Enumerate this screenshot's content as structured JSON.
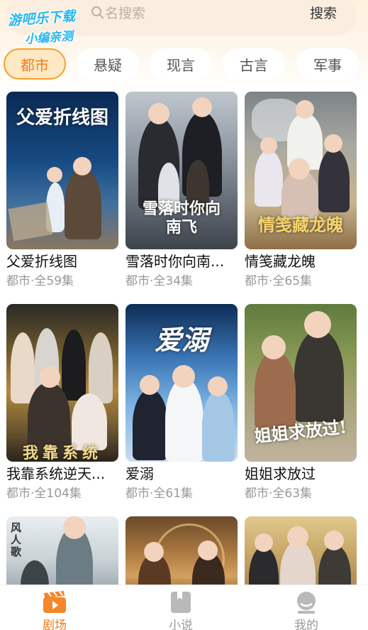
{
  "watermark": {
    "line1": "游吧乐下载",
    "line2": "小编亲测"
  },
  "search": {
    "placeholder": "名搜索",
    "button_label": "搜索"
  },
  "tabs": [
    {
      "label": "都市",
      "active": true
    },
    {
      "label": "悬疑",
      "active": false
    },
    {
      "label": "现言",
      "active": false
    },
    {
      "label": "古言",
      "active": false
    },
    {
      "label": "军事",
      "active": false
    }
  ],
  "dramas": [
    {
      "title": "父爱折线图",
      "meta": "都市·全59集",
      "poster_text": "父爱折线图"
    },
    {
      "title": "雪落时你向南...",
      "meta": "都市·全34集",
      "poster_text": "雪落时你向南飞"
    },
    {
      "title": "情笺藏龙魄",
      "meta": "都市·全65集",
      "poster_text": "情笺藏龙魄"
    },
    {
      "title": "我靠系统逆天...",
      "meta": "都市·全104集",
      "poster_text": "我靠系统"
    },
    {
      "title": "爱溺",
      "meta": "都市·全61集",
      "poster_text": "爱溺"
    },
    {
      "title": "姐姐求放过",
      "meta": "都市·全63集",
      "poster_text": "姐姐求放过!"
    },
    {
      "title": "",
      "meta": "",
      "poster_text": "风人歌"
    },
    {
      "title": "",
      "meta": "",
      "poster_text": ""
    },
    {
      "title": "",
      "meta": "",
      "poster_text": ""
    }
  ],
  "bottom_nav": [
    {
      "label": "剧场",
      "icon": "clapperboard-icon",
      "active": true
    },
    {
      "label": "小说",
      "icon": "book-icon",
      "active": false
    },
    {
      "label": "我的",
      "icon": "profile-icon",
      "active": false
    }
  ],
  "colors": {
    "accent": "#f07c1a",
    "tab_active_bg": "#ffe9c4",
    "nav_inactive": "#999999"
  }
}
